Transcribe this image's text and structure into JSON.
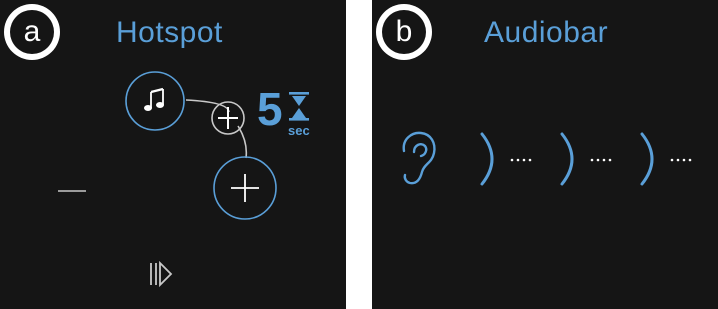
{
  "panels": [
    {
      "badge": "a",
      "title": "Hotspot",
      "timer": {
        "value": "5",
        "unit": "sec"
      },
      "icons": [
        "music-note-icon",
        "plus-icon",
        "plus-icon",
        "hourglass-icon",
        "minus-icon",
        "play-next-icon"
      ]
    },
    {
      "badge": "b",
      "title": "Audiobar",
      "icons": [
        "ear-icon",
        "sound-wave-icon"
      ],
      "segments": 3
    }
  ],
  "colors": {
    "background": "#151515",
    "accent": "#5a9fd8",
    "icon_gray": "#c8c8c8",
    "badge_ring": "#ffffff"
  }
}
